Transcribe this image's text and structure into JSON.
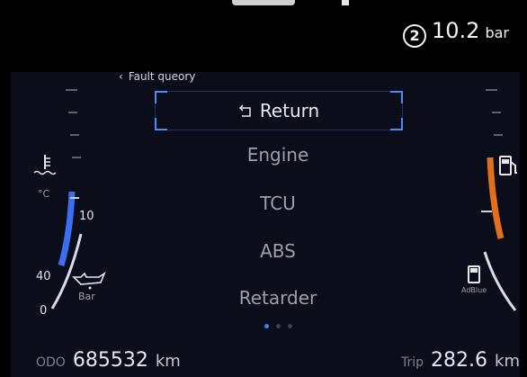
{
  "status": {
    "gear_indicator": "2",
    "pressure_value": "10.2",
    "pressure_unit": "bar"
  },
  "breadcrumb": {
    "label": "Fault queory"
  },
  "menu": {
    "return_label": "Return",
    "items": [
      {
        "label": "Engine"
      },
      {
        "label": "TCU"
      },
      {
        "label": "ABS"
      },
      {
        "label": "Retarder"
      }
    ],
    "page_count": 3,
    "active_page": 1
  },
  "left_gauges": {
    "temp_unit": "°C",
    "temp_tick_label": "10",
    "oil_tick_high": "40",
    "oil_tick_low": "0",
    "oil_unit": "Bar",
    "coolant_fill_fraction": 0.45,
    "accent_color": "#3a6ff0"
  },
  "right_gauges": {
    "fuel_fill_fraction": 0.6,
    "fuel_color": "#e0701b",
    "adblue_label": "AdBlue",
    "adblue_fill_fraction": 0.1
  },
  "odometer": {
    "label": "ODO",
    "value": "685532",
    "unit": "km"
  },
  "trip": {
    "label": "Trip",
    "value": "282.6",
    "unit": "km"
  }
}
